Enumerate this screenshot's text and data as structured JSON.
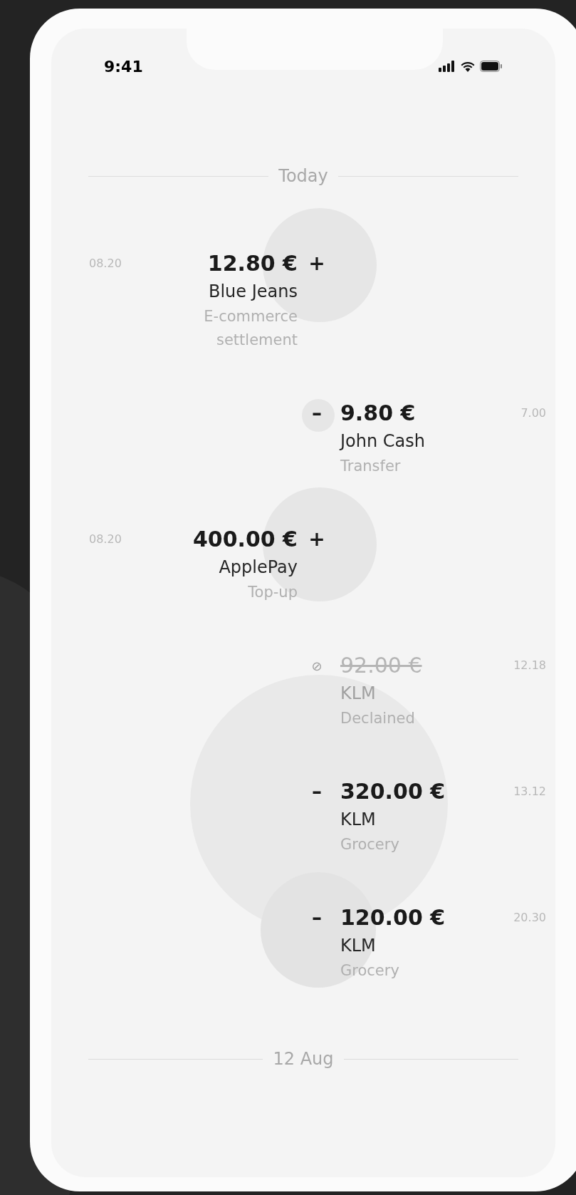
{
  "status_bar": {
    "time": "9:41"
  },
  "sections": [
    {
      "label": "Today",
      "transactions": [
        {
          "kind": "income",
          "time": "08.20",
          "sign": "+",
          "amount": "12.80 €",
          "name": "Blue Jeans",
          "description": "E-commerce settlement"
        },
        {
          "kind": "expense",
          "time": "7.00",
          "sign": "–",
          "amount": "9.80 €",
          "name": "John Cash",
          "description": "Transfer"
        },
        {
          "kind": "income",
          "time": "08.20",
          "sign": "+",
          "amount": "400.00 €",
          "name": "ApplePay",
          "description": "Top-up"
        },
        {
          "kind": "declined",
          "time": "12.18",
          "sign": "⊘",
          "amount": "92.00 €",
          "name": "KLM",
          "description": "Declained"
        },
        {
          "kind": "expense",
          "time": "13.12",
          "sign": "–",
          "amount": "320.00 €",
          "name": "KLM",
          "description": "Grocery"
        },
        {
          "kind": "expense",
          "time": "20.30",
          "sign": "–",
          "amount": "120.00 €",
          "name": "KLM",
          "description": "Grocery"
        }
      ]
    },
    {
      "label": "12 Aug"
    }
  ]
}
